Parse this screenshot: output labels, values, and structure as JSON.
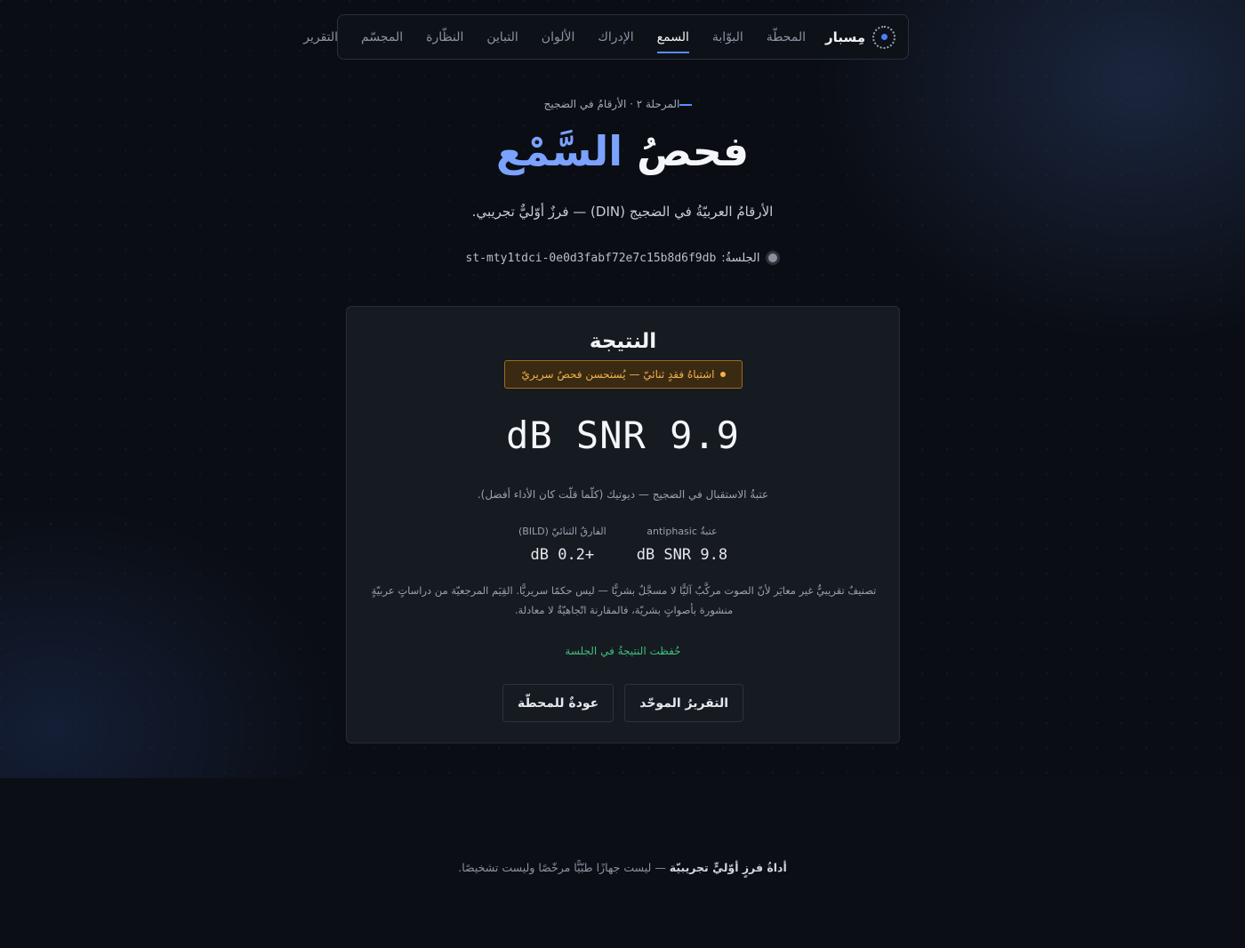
{
  "nav": {
    "brand": "مِسبار",
    "items": [
      {
        "label": "المحطّة",
        "active": false
      },
      {
        "label": "البوّابة",
        "active": false
      },
      {
        "label": "السمع",
        "active": true
      },
      {
        "label": "الإدراك",
        "active": false
      },
      {
        "label": "الألوان",
        "active": false
      },
      {
        "label": "التباين",
        "active": false
      },
      {
        "label": "النظّارة",
        "active": false
      },
      {
        "label": "المجسّم",
        "active": false
      },
      {
        "label": "التقرير",
        "active": false
      }
    ]
  },
  "hero": {
    "stage": "المرحلة ٢ · الأرقامُ في الضجيج",
    "title_main": "فحصُ",
    "title_accent": "السَّمْع",
    "subtitle": "الأرقامُ العربيّةُ في الضجيج (DIN) — فرزٌ أوّليٌّ تجريبي.",
    "session_label": "الجلسةُ:",
    "session_id": "st-mty1tdci-0e0d3fabf72e7c15b8d6f9db"
  },
  "result": {
    "title": "النتيجة",
    "badge": "اشتباهُ فقدٍ ثنائيّ — يُستحسن فحصٌ سريريّ",
    "srt_value": "dB SNR 9.9",
    "explain": "عتبةُ الاستقبال في الضجيج — ديوتيك (كلّما قلّت كان الأداء أفضل).",
    "metrics": [
      {
        "label": "عتبةُ antiphasic",
        "value": "dB SNR 9.8"
      },
      {
        "label": "الفارقُ الثنائيّ (BILD)",
        "value": "dB 0.2+"
      }
    ],
    "note": "تصنيفٌ تقريبيٌّ غير معايَر لأنّ الصوت مركَّبٌ آليًّا لا مسجَّلٌ بشريًّا — ليس حكمًا سريريًّا. القِيَم المرجعيّة من دراساتٍ عربيّةٍ منشورة بأصواتٍ بشريّة، فالمقارنة اتّجاهيّةٌ لا معادلة.",
    "saved": "حُفظت النتيجةُ في الجلسة",
    "btn_report": "التقريرُ الموحّد",
    "btn_back": "عودةٌ للمحطّة"
  },
  "footer": {
    "bold": "أداةُ فرزٍ أوّليٍّ تجريبيّة",
    "rest": " — ليست جهازًا طبّيًّا مرخّصًا وليست تشخيصًا."
  },
  "colors": {
    "accent": "#5b8cff",
    "warning": "#f0b24a",
    "success": "#3fbf7f",
    "background": "#0a0d14"
  }
}
